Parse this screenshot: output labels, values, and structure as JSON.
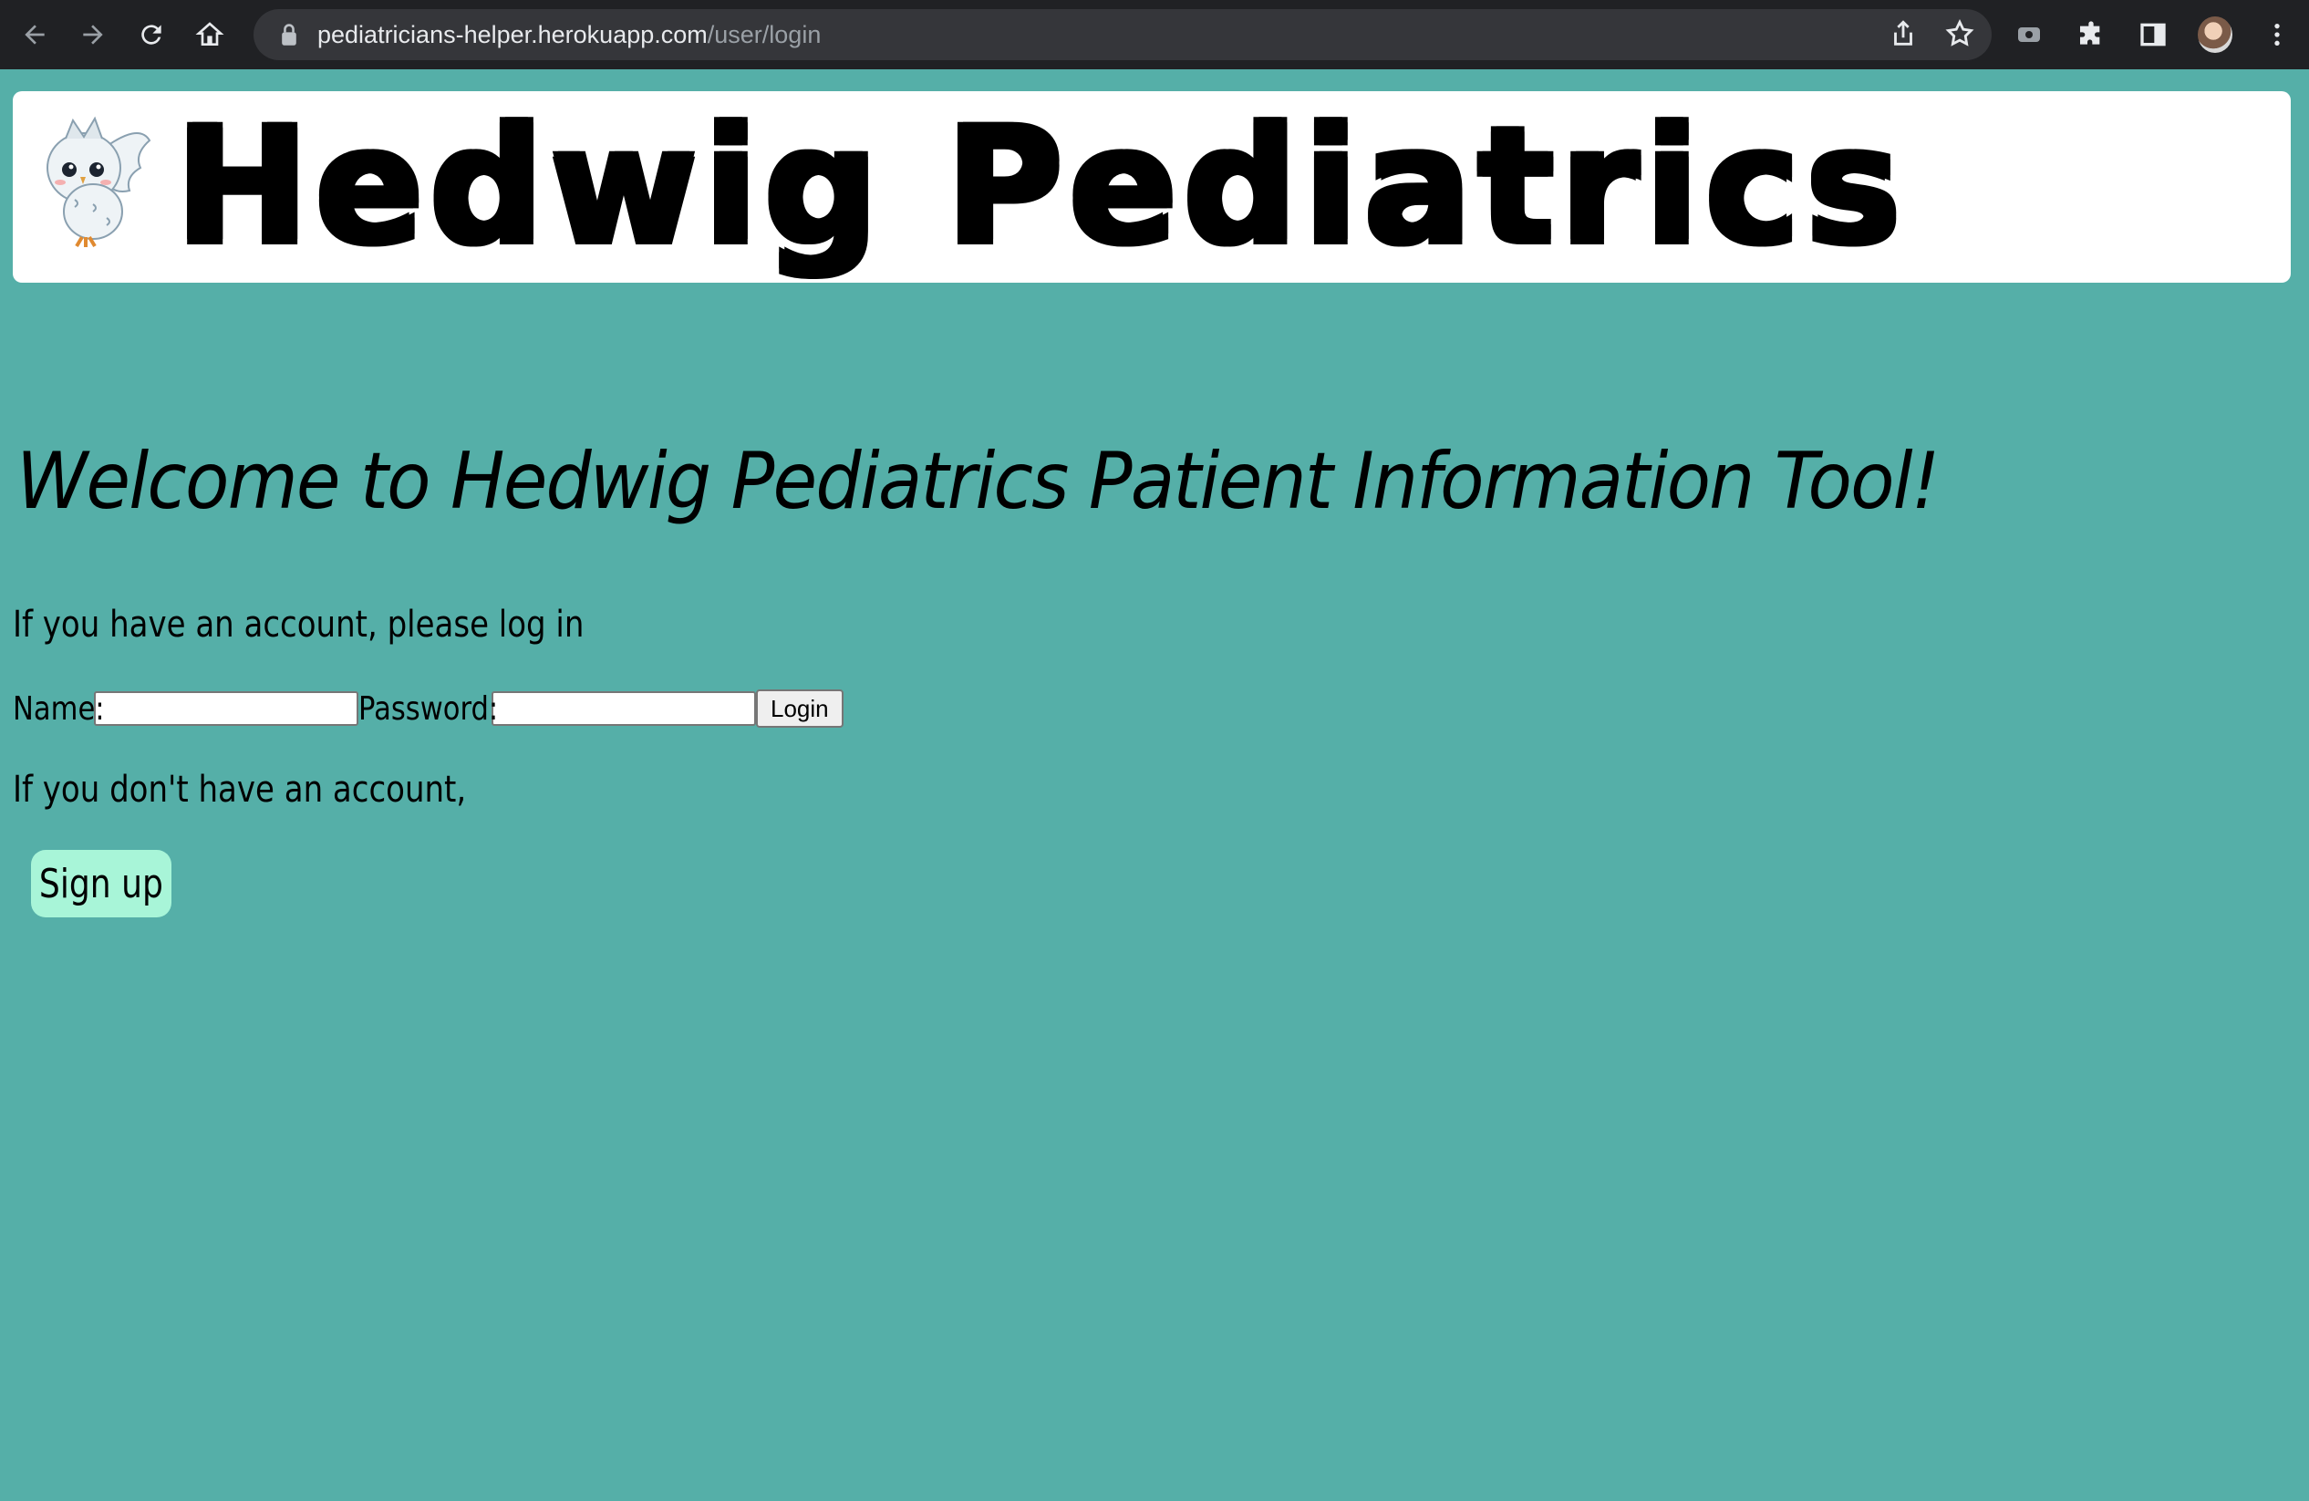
{
  "browser": {
    "url_host": "pediatricians-helper.herokuapp.com",
    "url_path": "/user/login",
    "icons": [
      "back-icon",
      "forward-icon",
      "reload-icon",
      "home-icon",
      "lock-icon",
      "share-icon",
      "star-icon",
      "media-icon",
      "extensions-icon",
      "sidepanel-icon",
      "avatar",
      "menu-icon"
    ]
  },
  "header": {
    "brand": "Hedwig Pediatrics",
    "logo_icon": "owl-icon"
  },
  "main": {
    "welcome": "Welcome to Hedwig Pediatrics Patient Information Tool!",
    "login_prompt": "If you have an account, please log in",
    "name_label": "Name:",
    "name_value": "",
    "password_label": "Password:",
    "password_value": "",
    "login_button": "Login",
    "signup_prompt": "If you don't have an account,",
    "signup_button": "Sign up"
  },
  "colors": {
    "page_bg": "#55afa8",
    "signup_bg": "#a8f5d8",
    "chrome_bg": "#202124"
  }
}
